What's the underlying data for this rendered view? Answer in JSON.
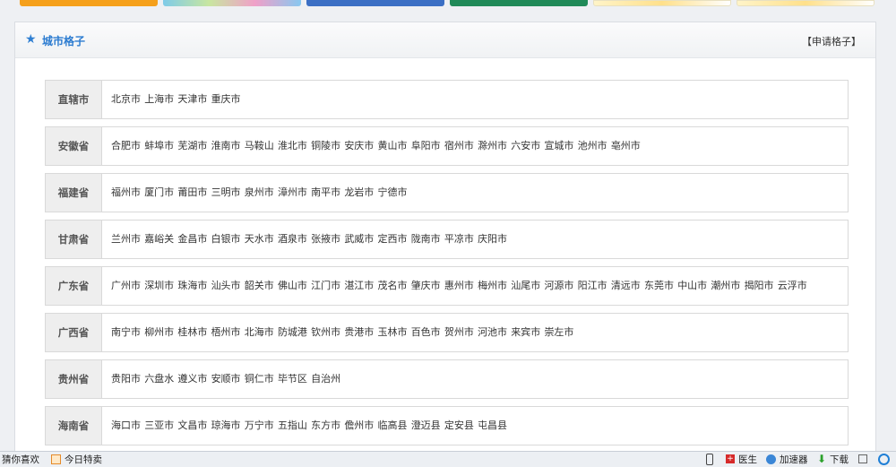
{
  "panel": {
    "title": "城市格子",
    "apply_link": "【申请格子】"
  },
  "provinces": [
    {
      "name": "直辖市",
      "cities": [
        "北京市",
        "上海市",
        "天津市",
        "重庆市"
      ]
    },
    {
      "name": "安徽省",
      "cities": [
        "合肥市",
        "蚌埠市",
        "芜湖市",
        "淮南市",
        "马鞍山",
        "淮北市",
        "铜陵市",
        "安庆市",
        "黄山市",
        "阜阳市",
        "宿州市",
        "滁州市",
        "六安市",
        "宣城市",
        "池州市",
        "亳州市"
      ]
    },
    {
      "name": "福建省",
      "cities": [
        "福州市",
        "厦门市",
        "莆田市",
        "三明市",
        "泉州市",
        "漳州市",
        "南平市",
        "龙岩市",
        "宁德市"
      ]
    },
    {
      "name": "甘肃省",
      "cities": [
        "兰州市",
        "嘉峪关",
        "金昌市",
        "白银市",
        "天水市",
        "酒泉市",
        "张掖市",
        "武威市",
        "定西市",
        "陇南市",
        "平凉市",
        "庆阳市"
      ]
    },
    {
      "name": "广东省",
      "cities": [
        "广州市",
        "深圳市",
        "珠海市",
        "汕头市",
        "韶关市",
        "佛山市",
        "江门市",
        "湛江市",
        "茂名市",
        "肇庆市",
        "惠州市",
        "梅州市",
        "汕尾市",
        "河源市",
        "阳江市",
        "清远市",
        "东莞市",
        "中山市",
        "潮州市",
        "揭阳市",
        "云浮市"
      ]
    },
    {
      "name": "广西省",
      "cities": [
        "南宁市",
        "柳州市",
        "桂林市",
        "梧州市",
        "北海市",
        "防城港",
        "钦州市",
        "贵港市",
        "玉林市",
        "百色市",
        "贺州市",
        "河池市",
        "来宾市",
        "崇左市"
      ]
    },
    {
      "name": "贵州省",
      "cities": [
        "贵阳市",
        "六盘水",
        "遵义市",
        "安顺市",
        "铜仁市",
        "毕节区",
        "自治州"
      ]
    },
    {
      "name": "海南省",
      "cities": [
        "海口市",
        "三亚市",
        "文昌市",
        "琼海市",
        "万宁市",
        "五指山",
        "东方市",
        "儋州市",
        "临高县",
        "澄迈县",
        "定安县",
        "屯昌县"
      ]
    }
  ],
  "status_bar": {
    "guess": "猜你喜欢",
    "today": "今日特卖",
    "doctor": "医生",
    "accelerator": "加速器",
    "download": "下载",
    "icons": [
      "gift-icon",
      "phone-icon",
      "doctor-icon",
      "speed-icon",
      "download-icon",
      "ime-icon",
      "ie-icon"
    ]
  },
  "colors": {
    "accent": "#2b7bd0",
    "label_bg": "#eeeeee",
    "border": "#d9d9d9"
  }
}
